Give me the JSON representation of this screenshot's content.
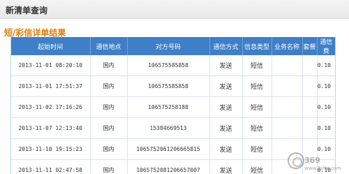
{
  "header": {
    "title": "新清单查询"
  },
  "section": {
    "title": "短/彩信详单结果"
  },
  "table": {
    "columns": [
      "起始时间",
      "通信地点",
      "对方号码",
      "通信方式",
      "信息类型",
      "业务名称",
      "套餐",
      "通信费"
    ],
    "rows": [
      [
        "2013-11-01 08:20:10",
        "国内",
        "106575585858",
        "发送",
        "短信",
        "",
        "",
        "0.10"
      ],
      [
        "2013-11-01 17:51:37",
        "国内",
        "106575585858",
        "发送",
        "短信",
        "",
        "",
        "0.10"
      ],
      [
        "2013-11-02 17:16:26",
        "国内",
        "106575258188",
        "发送",
        "短信",
        "",
        "",
        "0.10"
      ],
      [
        "2013-11-07 12:13:40",
        "国内",
        "15384669513",
        "发送",
        "短信",
        "",
        "",
        "0.10"
      ],
      [
        "2013-11-10 19:15:23",
        "国内",
        "1065752061206665815",
        "发送",
        "短信",
        "",
        "",
        "0.10"
      ],
      [
        "2013-11-11 02:47:58",
        "国内",
        "1065752081206657007",
        "发送",
        "短信",
        "",
        "",
        "0.10"
      ]
    ]
  },
  "watermark": {
    "text": "369",
    "url": "www.3sfix.com"
  }
}
